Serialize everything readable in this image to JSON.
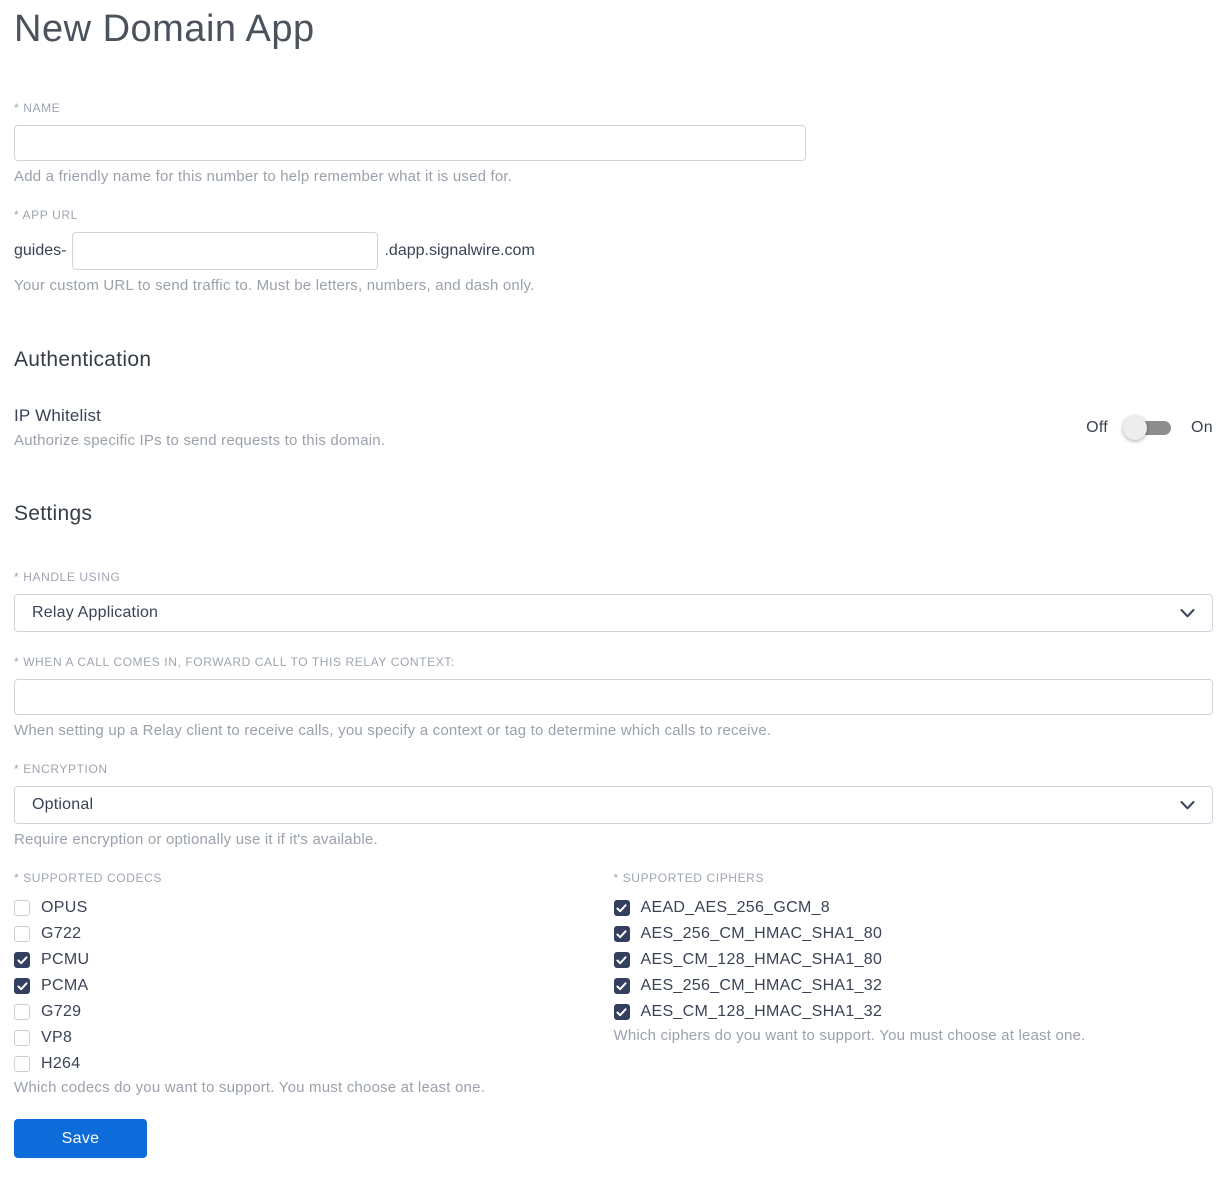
{
  "page": {
    "title": "New Domain App"
  },
  "name_field": {
    "label": "* NAME",
    "value": "",
    "helper": "Add a friendly name for this number to help remember what it is used for."
  },
  "app_url_field": {
    "label": "* APP URL",
    "prefix": "guides-",
    "value": "",
    "suffix": ".dapp.signalwire.com",
    "helper": "Your custom URL to send traffic to. Must be letters, numbers, and dash only."
  },
  "authentication": {
    "heading": "Authentication",
    "ip_whitelist": {
      "label": "IP Whitelist",
      "helper": "Authorize specific IPs to send requests to this domain.",
      "off_label": "Off",
      "on_label": "On",
      "enabled": false
    }
  },
  "settings": {
    "heading": "Settings",
    "handle_using": {
      "label": "* HANDLE USING",
      "value": "Relay Application"
    },
    "relay_context": {
      "label": "* WHEN A CALL COMES IN, FORWARD CALL TO THIS RELAY CONTEXT:",
      "value": "",
      "helper": "When setting up a Relay client to receive calls, you specify a context or tag to determine which calls to receive."
    },
    "encryption": {
      "label": "* ENCRYPTION",
      "value": "Optional",
      "helper": "Require encryption or optionally use it if it's available."
    },
    "codecs": {
      "label": "* SUPPORTED CODECS",
      "helper": "Which codecs do you want to support. You must choose at least one.",
      "options": [
        {
          "label": "OPUS",
          "checked": false
        },
        {
          "label": "G722",
          "checked": false
        },
        {
          "label": "PCMU",
          "checked": true
        },
        {
          "label": "PCMA",
          "checked": true
        },
        {
          "label": "G729",
          "checked": false
        },
        {
          "label": "VP8",
          "checked": false
        },
        {
          "label": "H264",
          "checked": false
        }
      ]
    },
    "ciphers": {
      "label": "* SUPPORTED CIPHERS",
      "helper": "Which ciphers do you want to support. You must choose at least one.",
      "options": [
        {
          "label": "AEAD_AES_256_GCM_8",
          "checked": true
        },
        {
          "label": "AES_256_CM_HMAC_SHA1_80",
          "checked": true
        },
        {
          "label": "AES_CM_128_HMAC_SHA1_80",
          "checked": true
        },
        {
          "label": "AES_256_CM_HMAC_SHA1_32",
          "checked": true
        },
        {
          "label": "AES_CM_128_HMAC_SHA1_32",
          "checked": true
        }
      ]
    }
  },
  "actions": {
    "save_label": "Save"
  },
  "icons": {
    "select_chevron": "chevron-down-icon",
    "checkbox_check": "check-icon"
  },
  "colors": {
    "accent_blue": "#0d6cd9",
    "checkbox_checked": "#333f5f",
    "toggle_track": "#8d8d8d",
    "toggle_knob": "#ededed",
    "input_border": "#ced4dd",
    "label_gray": "#9ea5b0",
    "helper_gray": "#9aa1ab",
    "text_dark": "#3a4254"
  }
}
